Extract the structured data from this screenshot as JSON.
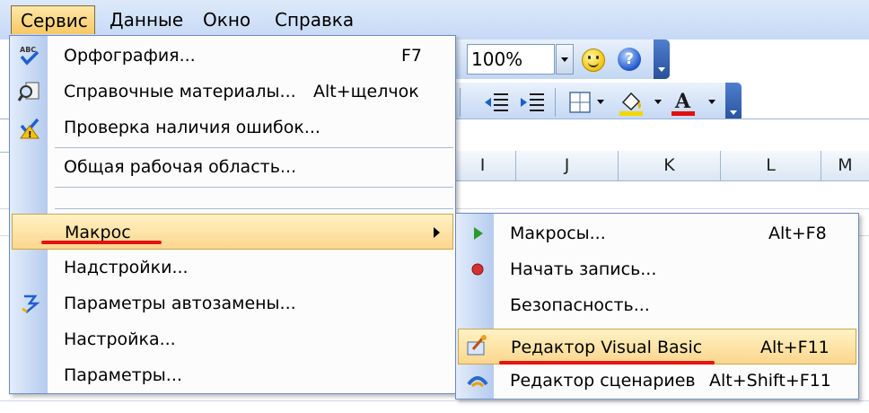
{
  "menubar": {
    "items": [
      {
        "label": "Сервис",
        "accel_index": 1,
        "active": true
      },
      {
        "label": "Данные",
        "accel_index": 0,
        "active": false
      },
      {
        "label": "Окно",
        "accel_index": 0,
        "active": false
      },
      {
        "label": "Справка",
        "accel_index": 0,
        "active": false
      }
    ]
  },
  "toolbar": {
    "zoom_value": "100%",
    "help_glyph": "?"
  },
  "columns": [
    "I",
    "J",
    "K",
    "L",
    "M"
  ],
  "main_menu": {
    "items": [
      {
        "label": "Орфография...",
        "shortcut": "F7",
        "icon": "spelling-abc-icon"
      },
      {
        "label": "Справочные материалы...",
        "shortcut": "Alt+щелчок",
        "icon": "research-icon"
      },
      {
        "label": "Проверка наличия ошибок...",
        "shortcut": "",
        "icon": "error-check-icon"
      },
      {
        "label": "Общая рабочая область...",
        "shortcut": "",
        "icon": ""
      },
      {
        "label": "",
        "shortcut": "",
        "icon": ""
      },
      {
        "label": "Макрос",
        "shortcut": "",
        "icon": "",
        "has_submenu": true,
        "highlighted": true
      },
      {
        "label": "Надстройки...",
        "shortcut": "",
        "icon": ""
      },
      {
        "label": "Параметры автозамены...",
        "shortcut": "",
        "icon": "autocorrect-icon"
      },
      {
        "label": "Настройка...",
        "shortcut": "",
        "icon": ""
      },
      {
        "label": "Параметры...",
        "shortcut": "",
        "icon": ""
      }
    ]
  },
  "sub_menu": {
    "items": [
      {
        "label": "Макросы...",
        "shortcut": "Alt+F8",
        "icon": "play-icon"
      },
      {
        "label": "Начать запись...",
        "shortcut": "",
        "icon": "record-icon"
      },
      {
        "label": "Безопасность...",
        "shortcut": "",
        "icon": ""
      },
      {
        "label": "Редактор Visual Basic",
        "shortcut": "Alt+F11",
        "icon": "vba-editor-icon",
        "highlighted": true
      },
      {
        "label": "Редактор сценариев",
        "shortcut": "Alt+Shift+F11",
        "icon": "script-editor-icon"
      }
    ]
  },
  "colors": {
    "highlight": "#fbd68e",
    "annotation_red": "#e41212",
    "menu_border": "#6b8ac0"
  }
}
